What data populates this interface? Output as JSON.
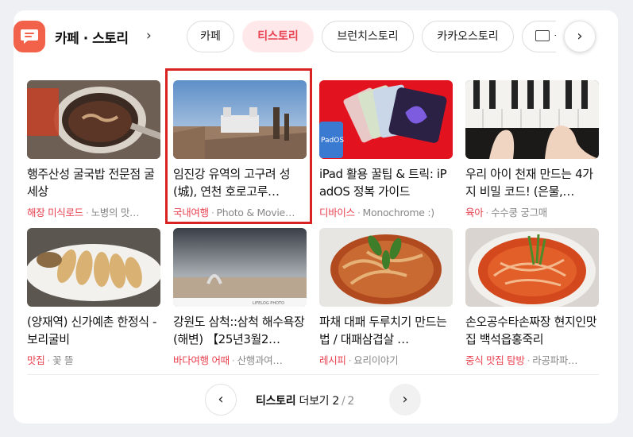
{
  "header": {
    "brand": "카페 · 스토리",
    "tabs": [
      {
        "label": "카페",
        "active": false
      },
      {
        "label": "티스토리",
        "active": true
      },
      {
        "label": "브런치스토리",
        "active": false
      },
      {
        "label": "카카오스토리",
        "active": false
      },
      {
        "label": "웅",
        "active": false
      }
    ]
  },
  "items": [
    {
      "title": "행주산성 굴국밥 전문점 굴세상",
      "category": "해장 미식로드",
      "blog": "노병의 맛…"
    },
    {
      "title": "임진강 유역의 고구려 성(城), 연천 호로고루…",
      "category": "국내여행",
      "blog": "Photo & Movie…"
    },
    {
      "title": "iPad 활용 꿀팁 & 트릭: iPadOS 정복 가이드",
      "category": "디바이스",
      "blog": "Monochrome :)"
    },
    {
      "title": "우리 아이 천재 만드는 4가지 비밀 코드! (은물,…",
      "category": "육아",
      "blog": "수수쿵 궁그매"
    },
    {
      "title": "(양재역) 신가예촌 한정식 - 보리굴비",
      "category": "맛집",
      "blog": "꽃 뜰"
    },
    {
      "title": "강원도 삼척::삼척 해수욕장(해변) 【25년3월2…",
      "category": "바다여행 어때",
      "blog": "산행과여…"
    },
    {
      "title": "파채 대패 두루치기 만드는 법 / 대패삼겹살 …",
      "category": "레시피",
      "blog": "요리이야기"
    },
    {
      "title": "손오공수타손짜장 현지인맛집 백석읍홍죽리",
      "category": "중식 맛집 탐방",
      "blog": "라공파파…"
    }
  ],
  "thumb_watermark": "LIFELOG PHOTO",
  "ipad_label": "PadOS",
  "pager": {
    "label": "티스토리",
    "suffix": "더보기",
    "current": "2",
    "separator": "/",
    "total": "2"
  },
  "colors": {
    "accent": "#e8414f",
    "logo": "#f2624b",
    "highlight_box": "#d92222"
  }
}
